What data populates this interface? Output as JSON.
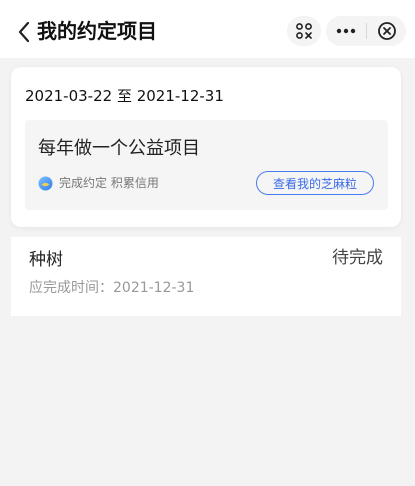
{
  "header": {
    "title": "我的约定项目",
    "back_icon": "chevron-left-icon",
    "scan_icon": "scan-icon",
    "more_icon": "more-dots-icon",
    "close_icon": "close-circle-icon"
  },
  "card": {
    "date_range": "2021-03-22 至 2021-12-31",
    "project_title": "每年做一个公益项目",
    "credit_text": "完成约定 积累信用",
    "credit_icon": "credit-badge-icon",
    "zhima_button": "查看我的芝麻粒",
    "accent_color": "#3a6be8"
  },
  "task": {
    "name": "种树",
    "status": "待完成",
    "due_text": "应完成时间：2021-12-31"
  }
}
